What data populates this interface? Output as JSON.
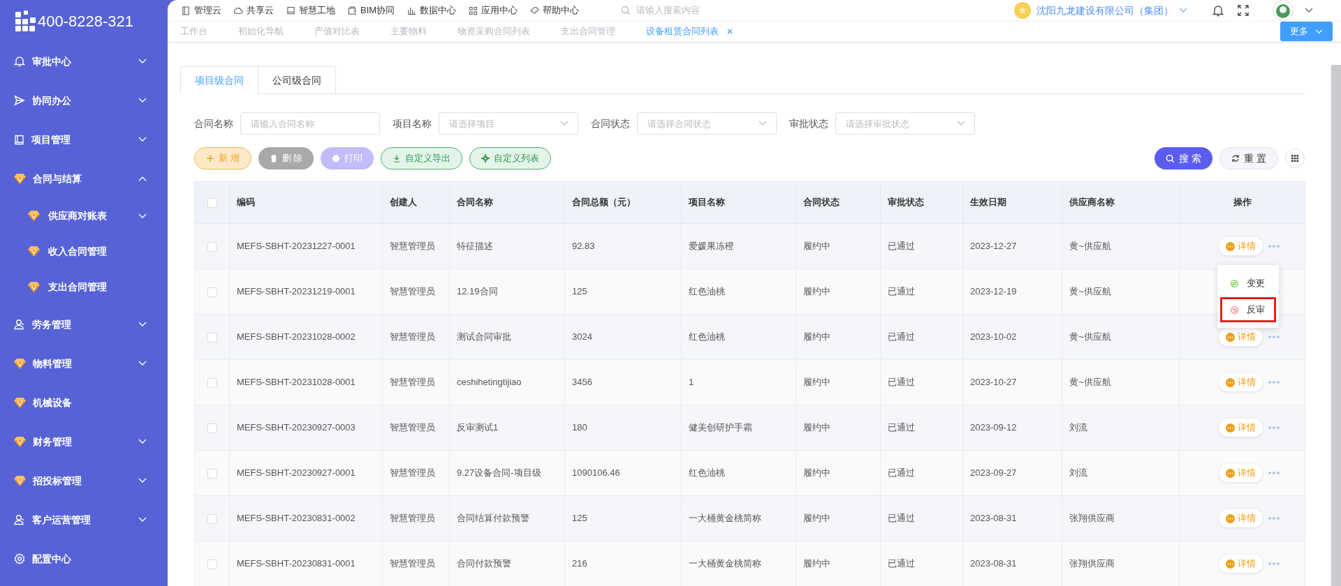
{
  "logo": {
    "phone": "400-8228-321"
  },
  "sidebar": {
    "items": [
      {
        "label": "审批中心",
        "kind": "bell",
        "expanded": false
      },
      {
        "label": "协同办公",
        "kind": "send",
        "expanded": false
      },
      {
        "label": "项目管理",
        "kind": "book",
        "expanded": false
      },
      {
        "label": "合同与结算",
        "kind": "gem",
        "expanded": true,
        "children": [
          {
            "label": "供应商对账表",
            "kind": "gem",
            "expanded": false
          },
          {
            "label": "收入合同管理",
            "kind": "gem"
          },
          {
            "label": "支出合同管理",
            "kind": "gem"
          }
        ]
      },
      {
        "label": "劳务管理",
        "kind": "user",
        "expanded": false
      },
      {
        "label": "物料管理",
        "kind": "gem",
        "expanded": false
      },
      {
        "label": "机械设备",
        "kind": "gem"
      },
      {
        "label": "财务管理",
        "kind": "gem",
        "expanded": false
      },
      {
        "label": "招投标管理",
        "kind": "gem",
        "expanded": false
      },
      {
        "label": "客户运营管理",
        "kind": "user",
        "expanded": false
      },
      {
        "label": "配置中心",
        "kind": "gear"
      }
    ]
  },
  "top_nav": [
    {
      "label": "管理云",
      "kind": "doc"
    },
    {
      "label": "共享云",
      "kind": "cloud"
    },
    {
      "label": "智慧工地",
      "kind": "book"
    },
    {
      "label": "BIM协同",
      "kind": "box"
    },
    {
      "label": "数据中心",
      "kind": "chart"
    },
    {
      "label": "应用中心",
      "kind": "grid"
    },
    {
      "label": "帮助中心",
      "kind": "tag"
    }
  ],
  "search": {
    "placeholder": "请输入搜索内容"
  },
  "company": "沈阳九龙建设有限公司（集团）",
  "page_tabs": [
    {
      "label": "工作台",
      "selected": false
    },
    {
      "label": "初始化导航",
      "selected": false
    },
    {
      "label": "产值对比表",
      "selected": false
    },
    {
      "label": "主要物料",
      "selected": false
    },
    {
      "label": "物资采购合同列表",
      "selected": false
    },
    {
      "label": "支出合同管理",
      "selected": false
    },
    {
      "label": "设备租赁合同列表",
      "selected": true
    }
  ],
  "more_button": "更多",
  "content_tabs": [
    {
      "label": "项目级合同",
      "selected": true
    },
    {
      "label": "公司级合同",
      "selected": false
    }
  ],
  "filters": [
    {
      "label": "合同名称",
      "placeholder": "请输入合同名称",
      "kind": "input"
    },
    {
      "label": "项目名称",
      "placeholder": "请选择项目",
      "kind": "select"
    },
    {
      "label": "合同状态",
      "placeholder": "请选择合同状态",
      "kind": "select"
    },
    {
      "label": "审批状态",
      "placeholder": "请选择审批状态",
      "kind": "select"
    }
  ],
  "actions": [
    {
      "label": "新 增",
      "kind": "add"
    },
    {
      "label": "删 除",
      "kind": "delete"
    },
    {
      "label": "打印",
      "kind": "print"
    },
    {
      "label": "自定义导出",
      "kind": "export"
    },
    {
      "label": "自定义列表",
      "kind": "columns"
    }
  ],
  "search_button": "搜 索",
  "reset_button": "重 置",
  "table": {
    "all_checked": false,
    "columns": [
      "编码",
      "创建人",
      "合同名称",
      "合同总额（元）",
      "项目名称",
      "合同状态",
      "审批状态",
      "生效日期",
      "供应商名称",
      "操作"
    ],
    "rows": [
      {
        "checked": false,
        "cells": [
          "MEFS-SBHT-20231227-0001",
          "智慧管理员",
          "特征描述",
          "92.83",
          "爱媛果冻橙",
          "履约中",
          "已通过",
          "2023-12-27",
          "黄~供应航"
        ],
        "action": "详情"
      },
      {
        "checked": false,
        "cells": [
          "MEFS-SBHT-20231219-0001",
          "智慧管理员",
          "12.19合同",
          "125",
          "红色油桃",
          "履约中",
          "已通过",
          "2023-12-19",
          "黄~供应航"
        ]
      },
      {
        "checked": false,
        "cells": [
          "MEFS-SBHT-20231028-0002",
          "智慧管理员",
          "测试合同审批",
          "3024",
          "红色油桃",
          "履约中",
          "已通过",
          "2023-10-02",
          "黄~供应航"
        ],
        "action": "详情"
      },
      {
        "checked": false,
        "cells": [
          "MEFS-SBHT-20231028-0001",
          "智慧管理员",
          "ceshihetingtijiao",
          "3456",
          "1",
          "履约中",
          "已通过",
          "2023-10-27",
          "黄~供应航"
        ],
        "action": "详情"
      },
      {
        "checked": false,
        "cells": [
          "MEFS-SBHT-20230927-0003",
          "智慧管理员",
          "反审测试1",
          "180",
          "健美创研护手霜",
          "履约中",
          "已通过",
          "2023-09-12",
          "刘流"
        ],
        "action": "详情"
      },
      {
        "checked": false,
        "cells": [
          "MEFS-SBHT-20230927-0001",
          "智慧管理员",
          "9.27设备合同-项目级",
          "1090106.46",
          "红色油桃",
          "履约中",
          "已通过",
          "2023-09-27",
          "刘流"
        ],
        "action": "详情"
      },
      {
        "checked": false,
        "cells": [
          "MEFS-SBHT-20230831-0002",
          "智慧管理员",
          "合同结算付款预警",
          "125",
          "一大桶黄金桃简称",
          "履约中",
          "已通过",
          "2023-08-31",
          "张翔供应商"
        ],
        "action": "详情"
      },
      {
        "checked": false,
        "cells": [
          "MEFS-SBHT-20230831-0001",
          "智慧管理员",
          "合同付款预警",
          "216",
          "一大桶黄金桃简称",
          "履约中",
          "已通过",
          "2023-08-31",
          "张翔供应商"
        ],
        "action": "详情"
      }
    ]
  },
  "row_menu": {
    "items": [
      {
        "label": "变更",
        "kind": "change",
        "highlighted": false
      },
      {
        "label": "反审",
        "kind": "revoke",
        "highlighted": true
      }
    ]
  }
}
